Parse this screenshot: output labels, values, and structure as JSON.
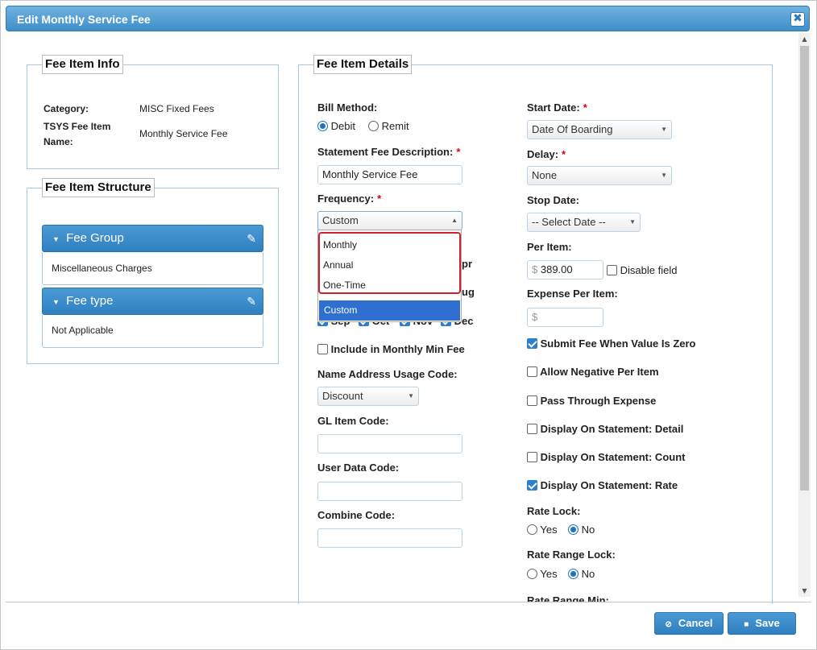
{
  "dialog": {
    "title": "Edit Monthly Service Fee",
    "close_glyph": "✖"
  },
  "fee_item_info": {
    "legend": "Fee Item Info",
    "category_label": "Category:",
    "category_value": "MISC Fixed Fees",
    "item_name_label_1": "TSYS Fee Item",
    "item_name_label_2": "Name:",
    "item_name_value": "Monthly Service Fee"
  },
  "fee_item_structure": {
    "legend": "Fee Item Structure",
    "fee_group": {
      "title": "Fee Group",
      "value": "Miscellaneous Charges"
    },
    "fee_type": {
      "title": "Fee type",
      "value": "Not Applicable"
    }
  },
  "details": {
    "legend": "Fee Item Details",
    "bill_method_label": "Bill Method:",
    "bill_method_options": [
      "Debit",
      "Remit"
    ],
    "bill_method_selected": "Debit",
    "statement_desc_label": "Statement Fee Description:",
    "statement_desc_value": "Monthly Service Fee",
    "frequency_label": "Frequency:",
    "frequency_value": "Custom",
    "frequency_options": [
      "Monthly",
      "Annual",
      "One-Time",
      "Custom"
    ],
    "hidden_month_fragments": [
      "pr",
      "ug"
    ],
    "months_row": [
      {
        "label": "Sep",
        "checked": true
      },
      {
        "label": "Oct",
        "checked": true
      },
      {
        "label": "Nov",
        "checked": true
      },
      {
        "label": "Dec",
        "checked": true
      }
    ],
    "include_min_fee_label": "Include in Monthly Min Fee",
    "name_address_label": "Name Address Usage Code:",
    "name_address_value": "Discount",
    "gl_item_label": "GL Item Code:",
    "gl_item_value": "",
    "user_data_label": "User Data Code:",
    "user_data_value": "",
    "combine_code_label": "Combine Code:",
    "combine_code_value": "",
    "start_date_label": "Start Date:",
    "start_date_value": "Date Of Boarding",
    "delay_label": "Delay:",
    "delay_value": "None",
    "stop_date_label": "Stop Date:",
    "stop_date_value": "-- Select Date --",
    "per_item_label": "Per Item:",
    "currency_symbol": "$",
    "per_item_value": "389.00",
    "disable_field_label": "Disable field",
    "expense_per_item_label": "Expense Per Item:",
    "expense_per_item_value": "",
    "submit_zero_label": "Submit Fee When Value Is Zero",
    "allow_negative_label": "Allow Negative Per Item",
    "pass_through_label": "Pass Through Expense",
    "display_detail_label": "Display On Statement: Detail",
    "display_count_label": "Display On Statement: Count",
    "display_rate_label": "Display On Statement: Rate",
    "rate_lock_label": "Rate Lock:",
    "rate_range_lock_label": "Rate Range Lock:",
    "yes_label": "Yes",
    "no_label": "No",
    "rate_range_min_label": "Rate Range Min:"
  },
  "footer": {
    "cancel_label": "Cancel",
    "save_label": "Save"
  },
  "colors": {
    "accent": "#3e8fc9",
    "required": "#dd0000",
    "selected_option": "#2f6fd0",
    "highlight_border": "#d0202a"
  }
}
